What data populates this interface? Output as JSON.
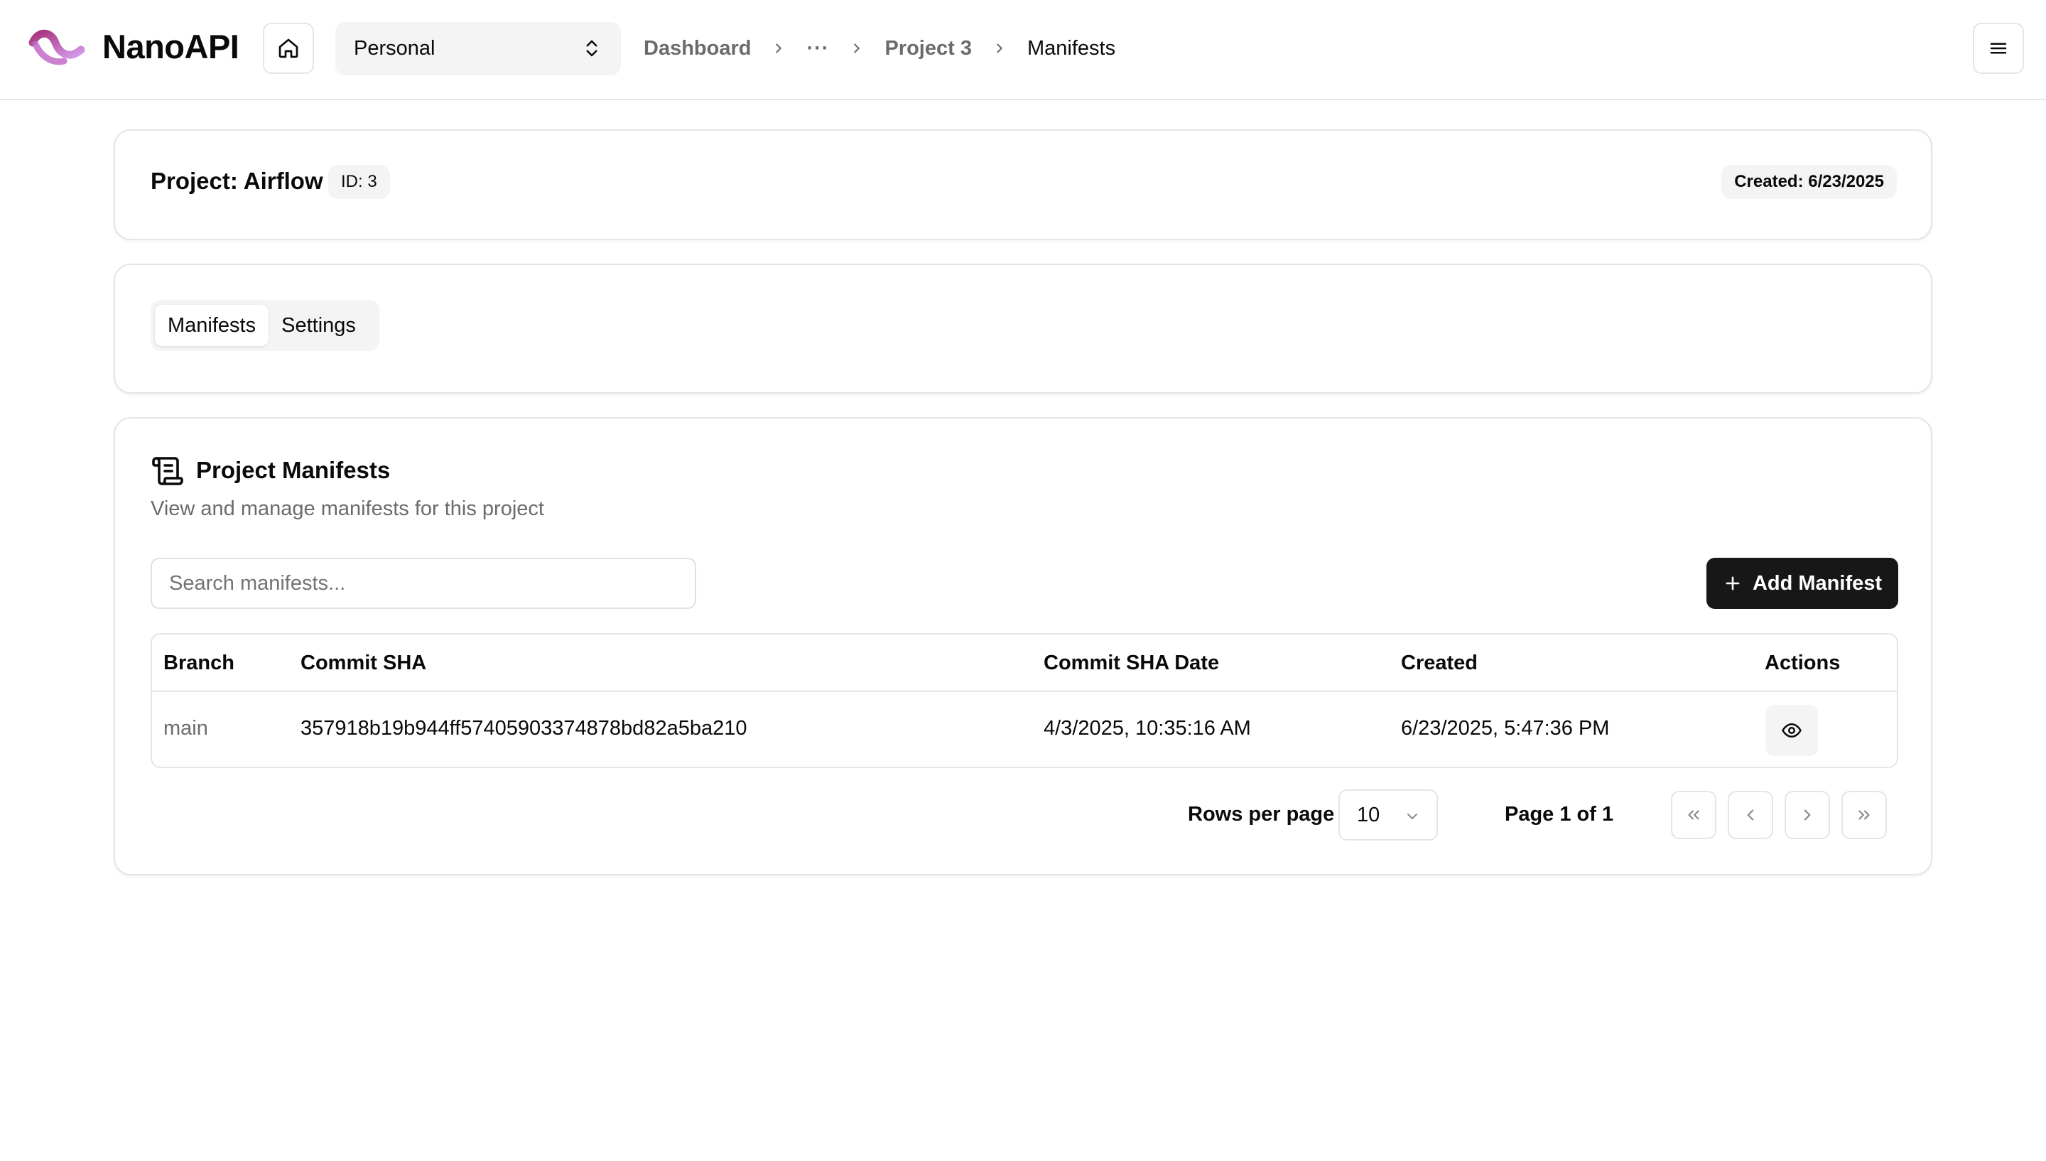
{
  "app": {
    "brand": "NanoAPI"
  },
  "header": {
    "org_selected": "Personal",
    "breadcrumb": {
      "dashboard": "Dashboard",
      "ellipsis": "···",
      "project": "Project 3",
      "current": "Manifests"
    }
  },
  "project": {
    "title": "Project: Airflow",
    "id_badge": "ID: 3",
    "created_badge": "Created: 6/23/2025"
  },
  "tabs": [
    {
      "label": "Manifests",
      "active": true
    },
    {
      "label": "Settings",
      "active": false
    }
  ],
  "manifests": {
    "title": "Project Manifests",
    "description": "View and manage manifests for this project",
    "search_placeholder": "Search manifests...",
    "add_button": "Add Manifest",
    "columns": [
      "Branch",
      "Commit SHA",
      "Commit SHA Date",
      "Created",
      "Actions"
    ],
    "rows": [
      {
        "branch": "main",
        "commit_sha": "357918b19b944ff57405903374878bd82a5ba210",
        "commit_sha_date": "4/3/2025, 10:35:16 AM",
        "created": "6/23/2025, 5:47:36 PM"
      }
    ]
  },
  "pagination": {
    "rows_per_page_label": "Rows per page",
    "rows_per_page_value": "10",
    "page_label": "Page 1 of 1"
  },
  "colors": {
    "logo_gradient_start": "#b63a8c",
    "logo_gradient_end": "#c78be6",
    "primary_button": "#171717",
    "muted_bg": "#f4f4f5",
    "border": "#e5e5e5"
  },
  "icons": {
    "logo": "nanoapi-wave-logo",
    "home": "home-icon",
    "selector": "chevrons-up-down-icon",
    "breadcrumb_separator": "chevron-right-icon",
    "menu": "menu-icon",
    "manifests": "scroll-text-icon",
    "add": "plus-icon",
    "view": "eye-icon",
    "first_page": "chevrons-left-icon",
    "prev_page": "chevron-left-icon",
    "next_page": "chevron-right-icon",
    "last_page": "chevrons-right-icon"
  }
}
